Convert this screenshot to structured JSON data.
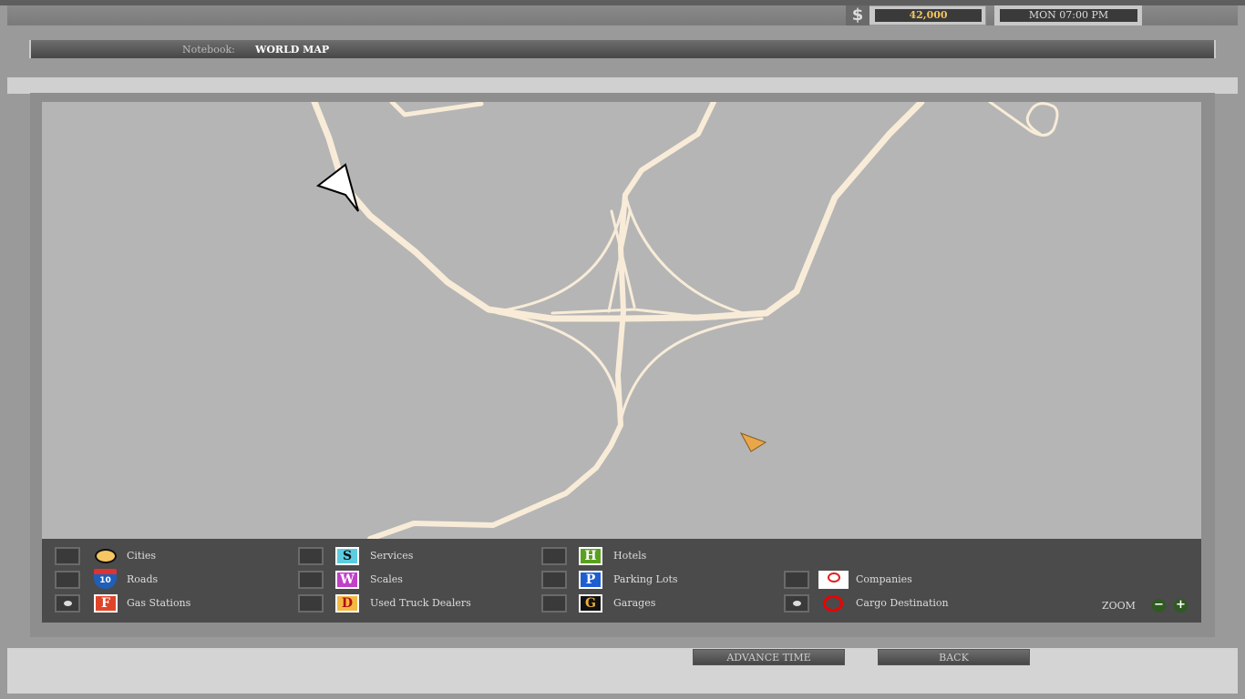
{
  "hud": {
    "currency_symbol": "$",
    "cash": "42,000",
    "time": "MON 07:00 PM"
  },
  "notebook": {
    "label": "Notebook:",
    "title": "WORLD MAP"
  },
  "legend": {
    "items": [
      {
        "label": "Cities",
        "icon": "city-icon",
        "checked": false
      },
      {
        "label": "Roads",
        "icon": "interstate-shield-icon",
        "icon_text": "10",
        "checked": false
      },
      {
        "label": "Gas Stations",
        "icon": "gas-station-icon",
        "icon_text": "F",
        "checked": true
      },
      {
        "label": "Services",
        "icon": "services-icon",
        "icon_text": "S",
        "checked": false
      },
      {
        "label": "Scales",
        "icon": "scales-icon",
        "icon_text": "W",
        "checked": false
      },
      {
        "label": "Used Truck Dealers",
        "icon": "used-truck-dealers-icon",
        "icon_text": "D",
        "checked": false
      },
      {
        "label": "Hotels",
        "icon": "hotel-icon",
        "icon_text": "H",
        "checked": false
      },
      {
        "label": "Parking Lots",
        "icon": "parking-icon",
        "icon_text": "P",
        "checked": false
      },
      {
        "label": "Garages",
        "icon": "garage-icon",
        "icon_text": "G",
        "checked": false
      },
      {
        "label": "Companies",
        "icon": "company-logo-icon",
        "checked": false
      },
      {
        "label": "Cargo Destination",
        "icon": "cargo-destination-icon",
        "checked": true
      }
    ],
    "zoom_label": "ZOOM",
    "zoom_out": "−",
    "zoom_in": "+"
  },
  "buttons": {
    "advance_time": "ADVANCE TIME",
    "back": "BACK"
  },
  "colors": {
    "road": "#f8ecd8",
    "map_bg": "#b5b5b5",
    "cash": "#f2c460"
  }
}
